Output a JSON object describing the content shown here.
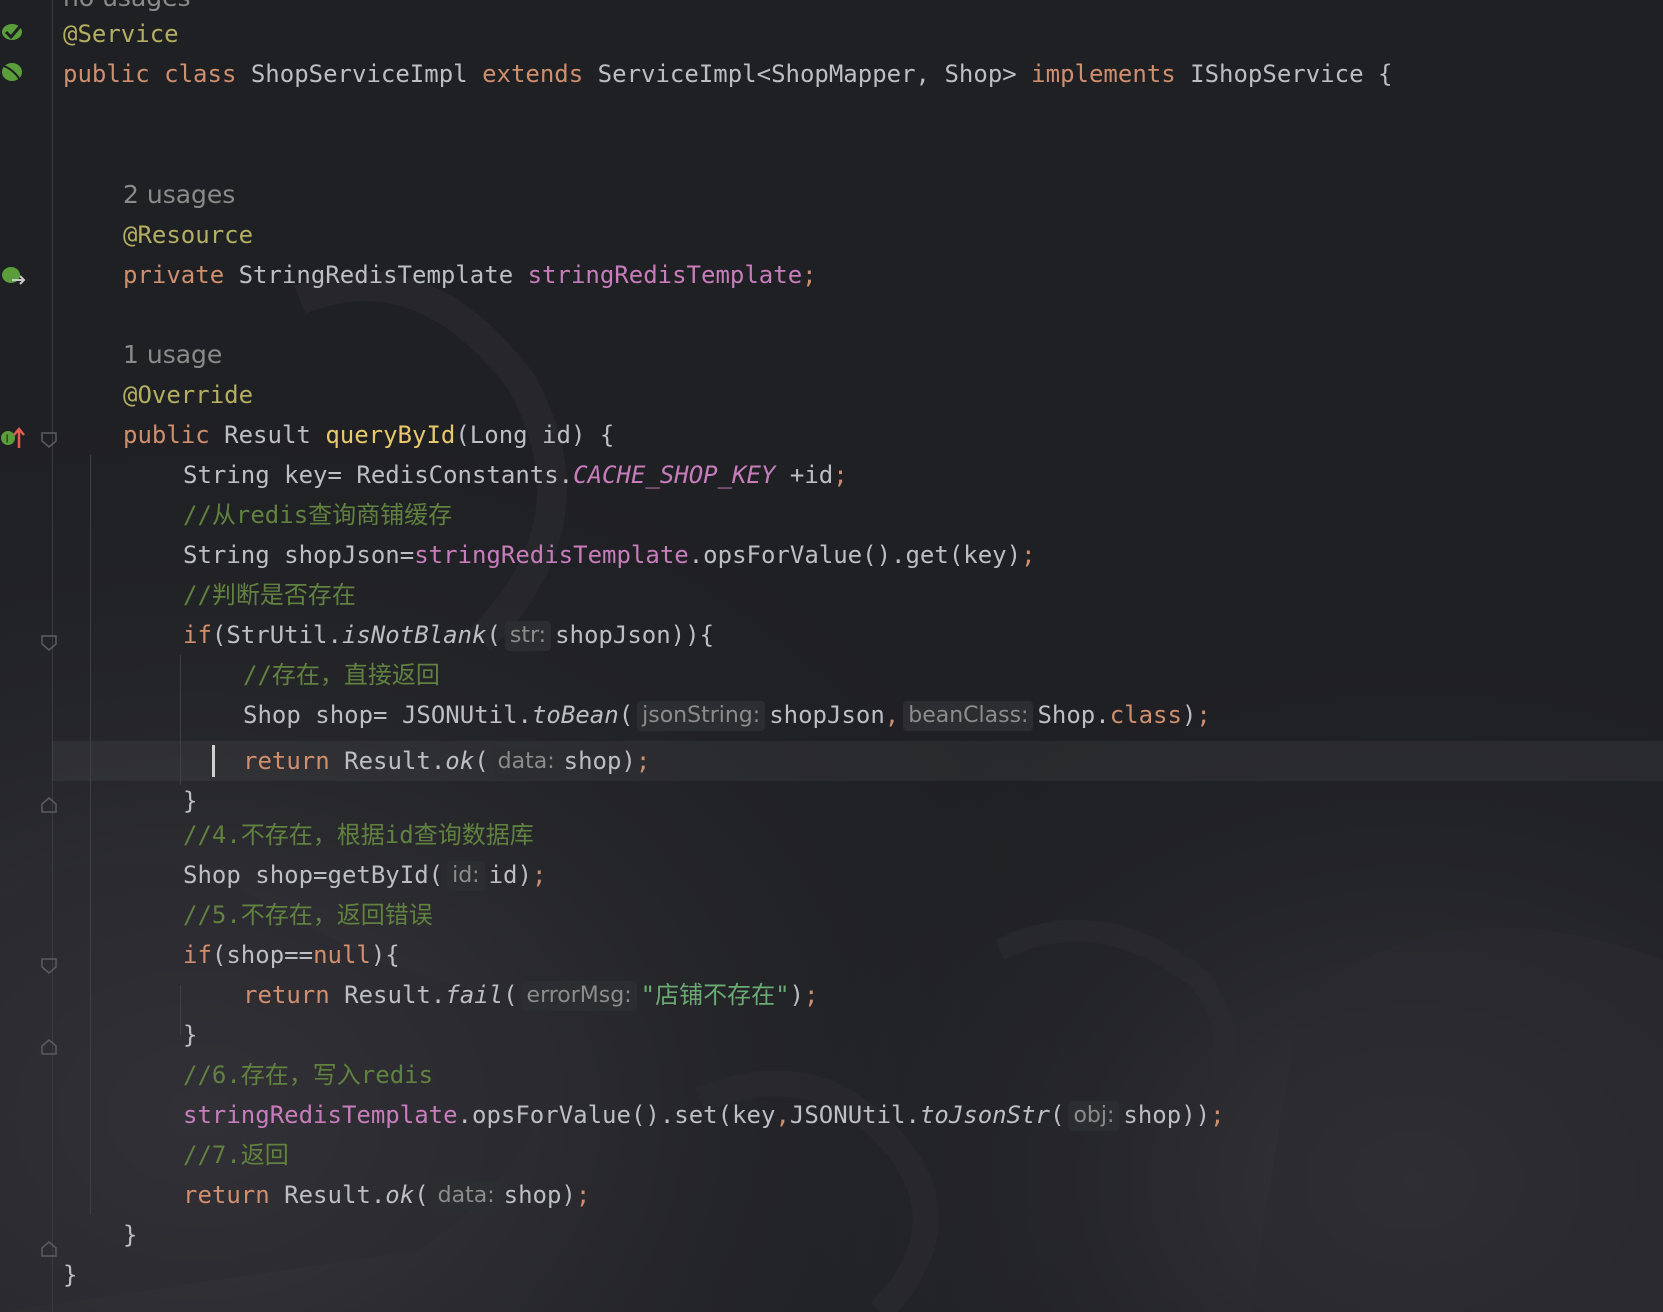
{
  "colors": {
    "background": "#1f2023",
    "keyword": "#cf8e6d",
    "annotation": "#b3ae60",
    "field": "#c77dbb",
    "method_decl": "#e8c86a",
    "comment": "#60813f",
    "string": "#6aab73",
    "plain": "#bcbec4",
    "hint": "#8c8c8c"
  },
  "top_usage": "no usages",
  "usages": {
    "field": "2 usages",
    "method": "1 usage"
  },
  "code": {
    "ann_service": "@Service",
    "class_decl": {
      "kw1": "public",
      "kw2": "class",
      "name": "ShopServiceImpl",
      "kw3": "extends",
      "base": "ServiceImpl<ShopMapper,",
      "base2": "Shop>",
      "kw4": "implements",
      "iface": "IShopService",
      "brace": "{"
    },
    "ann_resource": "@Resource",
    "field_decl": {
      "kw": "private",
      "type": "StringRedisTemplate",
      "name": "stringRedisTemplate",
      "semi": ";"
    },
    "ann_override": "@Override",
    "method_decl": {
      "kw": "public",
      "type": "Result",
      "name": "queryById",
      "params": "(Long id) {"
    },
    "l_key": {
      "p1": "String key= RedisConstants.",
      "const": "CACHE_SHOP_KEY",
      "p2": " +id",
      "semi": ";"
    },
    "c1": "//从redis查询商铺缓存",
    "l_json": {
      "p1": "String shopJson=",
      "fld": "stringRedisTemplate",
      "p2": ".opsForValue().get(key)",
      "semi": ";"
    },
    "c2": "//判断是否存在",
    "l_if1": {
      "kw": "if",
      "p1": "(StrUtil.",
      "fn": "isNotBlank",
      "p2": "(",
      "hint": "str:",
      "p3": "shopJson)){"
    },
    "c3": "//存在，直接返回",
    "l_bean": {
      "p1": "Shop shop= JSONUtil.",
      "fn": "toBean",
      "p2": "(",
      "hint1": "jsonString:",
      "p3": "shopJson",
      "comma": ",",
      "hint2": "beanClass:",
      "p4": "Shop.",
      "kw": "class",
      "p5": ")",
      "semi": ";"
    },
    "l_ret1": {
      "kw": "return",
      "p1": " Result.",
      "fn": "ok",
      "p2": "(",
      "hint": "data:",
      "p3": "shop)",
      "semi": ";"
    },
    "close1": "}",
    "c4": "//4.不存在，根据id查询数据库",
    "l_get": {
      "p1": "Shop shop=getById(",
      "hint": "id:",
      "p2": "id)",
      "semi": ";"
    },
    "c5": "//5.不存在，返回错误",
    "l_if2": {
      "kw": "if",
      "p1": "(shop==",
      "kw2": "null",
      "p2": "){"
    },
    "l_fail": {
      "kw": "return",
      "p1": " Result.",
      "fn": "fail",
      "p2": "(",
      "hint": "errorMsg:",
      "str": "\"店铺不存在\"",
      "p3": ")",
      "semi": ";"
    },
    "close2": "}",
    "c6": "//6.存在，写入redis",
    "l_set": {
      "fld": "stringRedisTemplate",
      "p1": ".opsForValue().set(key",
      "comma": ",",
      "p2": "JSONUtil.",
      "fn": "toJsonStr",
      "p3": "(",
      "hint": "obj:",
      "p4": "shop))",
      "semi": ";"
    },
    "c7": "//7.返回",
    "l_ret2": {
      "kw": "return",
      "p1": " Result.",
      "fn": "ok",
      "p2": "(",
      "hint": "data:",
      "p3": "shop)",
      "semi": ";"
    },
    "close3": "}",
    "close4": "}"
  },
  "gutter_icons": {
    "class_icon": "bean-class-icon",
    "field_icon": "autowired-field-icon",
    "method_icon": "implements-method-icon",
    "fold_icon": "fold-marker-icon"
  }
}
